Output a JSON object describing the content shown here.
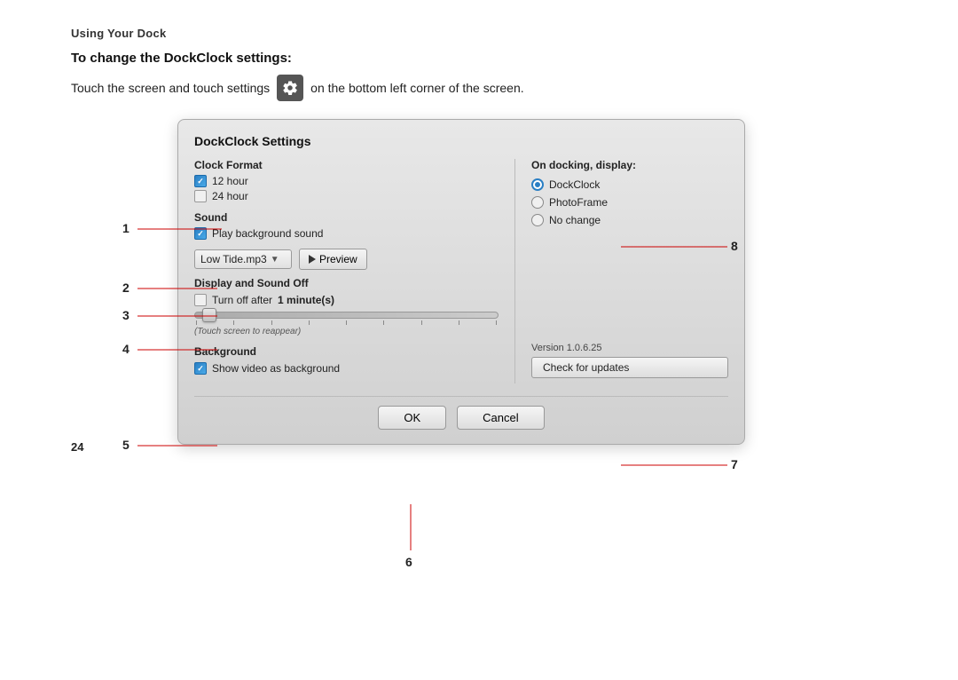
{
  "page": {
    "section_title": "Using Your Dock",
    "heading": "To change the DockClock settings:",
    "intro_before": "Touch the screen and touch settings",
    "intro_after": "on the bottom left corner of the screen.",
    "page_number": "24"
  },
  "dialog": {
    "title": "DockClock Settings",
    "clock_format_label": "Clock Format",
    "clock_12h": "12 hour",
    "clock_24h": "24 hour",
    "sound_label": "Sound",
    "play_bg_sound": "Play background sound",
    "sound_file": "Low Tide.mp3",
    "preview_btn": "Preview",
    "display_sound_off_label": "Display and Sound Off",
    "turn_off_text_before": "Turn off after",
    "turn_off_bold": "1 minute(s)",
    "slider_hint": "(Touch screen to reappear)",
    "background_label": "Background",
    "show_video": "Show video as background",
    "on_docking_label": "On docking, display:",
    "radio_dockclock": "DockClock",
    "radio_photoframe": "PhotoFrame",
    "radio_no_change": "No change",
    "version_text": "Version 1.0.6.25",
    "check_updates_btn": "Check for updates",
    "ok_btn": "OK",
    "cancel_btn": "Cancel"
  },
  "callouts": {
    "nums": [
      "1",
      "2",
      "3",
      "4",
      "5",
      "6",
      "7",
      "8"
    ]
  }
}
